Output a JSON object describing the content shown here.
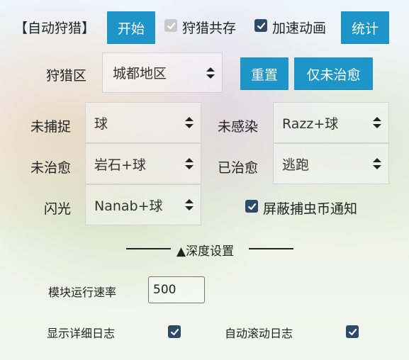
{
  "header": {
    "title": "【自动狩猎】",
    "start_label": "开始",
    "coexist_label": "狩猎共存",
    "coexist_checked": true,
    "speedup_label": "加速动画",
    "speedup_checked": true,
    "stats_label": "统计"
  },
  "hunt_zone": {
    "label": "狩猎区",
    "selected": "城都地区",
    "reset_label": "重置",
    "only_untreated_label": "仅未治愈"
  },
  "actions": {
    "uncaught": {
      "label": "未捕捉",
      "selected": "球"
    },
    "uninfected": {
      "label": "未感染",
      "selected": "Razz+球"
    },
    "untreated": {
      "label": "未治愈",
      "selected": "岩石+球"
    },
    "treated": {
      "label": "已治愈",
      "selected": "逃跑"
    },
    "shiny": {
      "label": "闪光",
      "selected": "Nanab+球"
    }
  },
  "block_bug_coin": {
    "label": "屏蔽捕虫币通知",
    "checked": true
  },
  "advanced": {
    "section_title": "▲深度设置",
    "module_rate_label": "模块运行速率",
    "module_rate_value": "500",
    "show_log_label": "显示详细日志",
    "show_log_checked": true,
    "auto_scroll_label": "自动滚动日志",
    "auto_scroll_checked": true
  },
  "colors": {
    "accent": "#1d95c8",
    "checkbox": "#2e4a66"
  }
}
